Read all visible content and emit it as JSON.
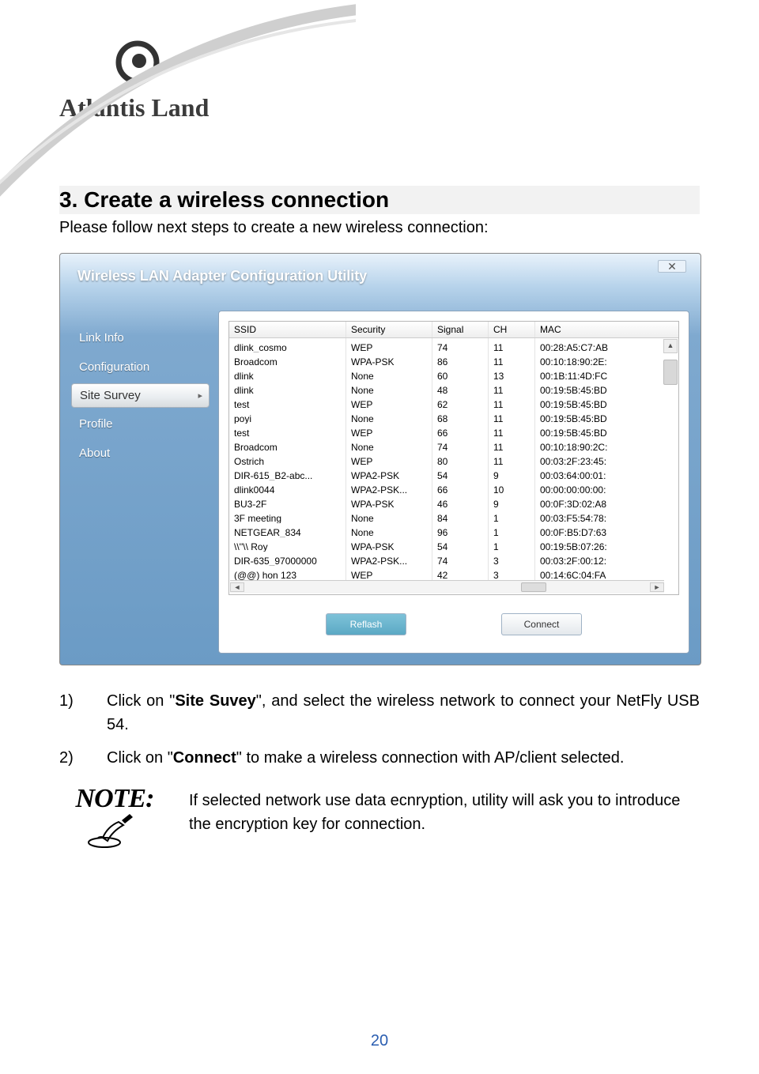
{
  "logo": {
    "brand": "Atlantis Land"
  },
  "section": {
    "heading": "3. Create a wireless connection",
    "intro": "Please follow next steps to create a new wireless connection:"
  },
  "screenshot": {
    "title": "Wireless LAN Adapter Configuration Utility",
    "close": "✕",
    "sidebar": {
      "items": [
        "Link Info",
        "Configuration",
        "Site Survey",
        "Profile",
        "About"
      ],
      "selected_index": 2
    },
    "table": {
      "headers": [
        "SSID",
        "Security",
        "Signal",
        "CH",
        "MAC"
      ],
      "rows": [
        [
          "dlink_cosmo",
          "WEP",
          "74",
          "11",
          "00:28:A5:C7:AB"
        ],
        [
          "Broadcom",
          "WPA-PSK",
          "86",
          "11",
          "00:10:18:90:2E:"
        ],
        [
          "dlink",
          "None",
          "60",
          "13",
          "00:1B:11:4D:FC"
        ],
        [
          "dlink",
          "None",
          "48",
          "11",
          "00:19:5B:45:BD"
        ],
        [
          "test",
          "WEP",
          "62",
          "11",
          "00:19:5B:45:BD"
        ],
        [
          "poyi",
          "None",
          "68",
          "11",
          "00:19:5B:45:BD"
        ],
        [
          "test",
          "WEP",
          "66",
          "11",
          "00:19:5B:45:BD"
        ],
        [
          "Broadcom",
          "None",
          "74",
          "11",
          "00:10:18:90:2C:"
        ],
        [
          "Ostrich",
          "WEP",
          "80",
          "11",
          "00:03:2F:23:45:"
        ],
        [
          "DIR-615_B2-abc...",
          "WPA2-PSK",
          "54",
          "9",
          "00:03:64:00:01:"
        ],
        [
          "dlink0044",
          "WPA2-PSK...",
          "66",
          "10",
          "00:00:00:00:00:"
        ],
        [
          "BU3-2F",
          "WPA-PSK",
          "46",
          "9",
          "00:0F:3D:02:A8"
        ],
        [
          "3F meeting",
          "None",
          "84",
          "1",
          "00:03:F5:54:78:"
        ],
        [
          "NETGEAR_834",
          "None",
          "96",
          "1",
          "00:0F:B5:D7:63"
        ],
        [
          "\\\\''\\\\    Roy",
          "WPA-PSK",
          "54",
          "1",
          "00:19:5B:07:26:"
        ],
        [
          "DIR-635_97000000",
          "WPA2-PSK...",
          "74",
          "3",
          "00:03:2F:00:12:"
        ],
        [
          "(@@) hon 123",
          "WEP",
          "42",
          "3",
          "00:14:6C:04:FA"
        ]
      ]
    },
    "buttons": {
      "reflash": "Reflash",
      "connect": "Connect"
    }
  },
  "steps": {
    "s1_num": "1)",
    "s1_a": "Click on \"",
    "s1_bold": "Site Suvey",
    "s1_b": "\", and select the wireless network to connect your NetFly USB 54.",
    "s2_num": "2)",
    "s2_a": "Click on \"",
    "s2_bold": "Connect",
    "s2_b": "\" to make a wireless connection with AP/client selected."
  },
  "note": {
    "label": "NOTE:",
    "text": "If selected network use data ecnryption, utility will ask you to introduce the encryption key for connection."
  },
  "page_number": "20"
}
